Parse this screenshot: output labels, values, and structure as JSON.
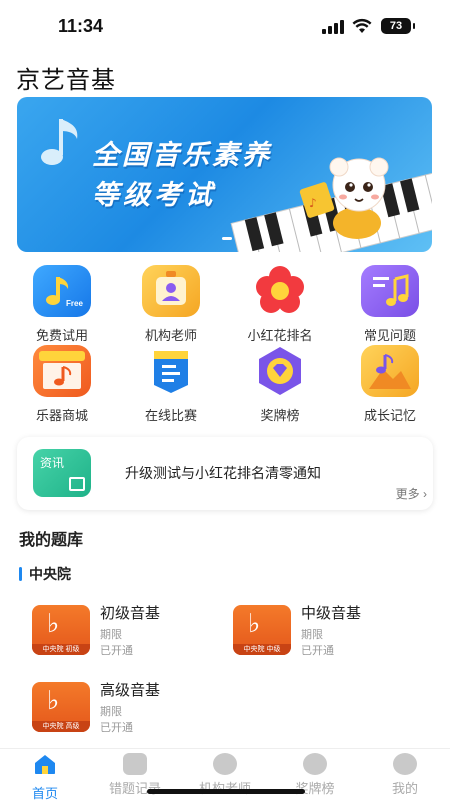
{
  "status_bar": {
    "time": "11:34",
    "battery": "73"
  },
  "app_title": "京艺音基",
  "banner": {
    "line1": "全国音乐素养",
    "line2": "等级考试"
  },
  "grid": [
    {
      "label": "免费试用",
      "icon": "music-note-free-icon",
      "color": "#1e8ff0"
    },
    {
      "label": "机构老师",
      "icon": "teacher-badge-icon",
      "color": "#f5c542"
    },
    {
      "label": "小红花排名",
      "icon": "red-flower-icon",
      "color": "#f0303a"
    },
    {
      "label": "常见问题",
      "icon": "faq-music-icon",
      "color": "#8a5cf0"
    },
    {
      "label": "乐器商城",
      "icon": "shop-icon",
      "color": "#f26b2c"
    },
    {
      "label": "在线比赛",
      "icon": "contest-flag-icon",
      "color": "#1f7fe6"
    },
    {
      "label": "奖牌榜",
      "icon": "medal-icon",
      "color": "#7a55e8"
    },
    {
      "label": "成长记忆",
      "icon": "growth-memory-icon",
      "color": "#f5b52c"
    }
  ],
  "notice": {
    "tag": "资讯",
    "text": "升级测试与小红花排名清零通知",
    "more": "更多"
  },
  "my_bank": {
    "title": "我的题库",
    "group": "中央院",
    "courses": [
      {
        "name": "初级音基",
        "period": "期限",
        "status": "已开通",
        "badge": "中央院 初级"
      },
      {
        "name": "中级音基",
        "period": "期限",
        "status": "已开通",
        "badge": "中央院 中级"
      },
      {
        "name": "高级音基",
        "period": "期限",
        "status": "已开通",
        "badge": "中央院 高级"
      }
    ]
  },
  "tabs": [
    {
      "label": "首页",
      "icon": "home-icon"
    },
    {
      "label": "错题记录",
      "icon": "wrong-record-icon"
    },
    {
      "label": "机构老师",
      "icon": "institution-teacher-icon"
    },
    {
      "label": "奖牌榜",
      "icon": "medal-rank-icon"
    },
    {
      "label": "我的",
      "icon": "profile-icon"
    }
  ],
  "colors": {
    "accent": "#1e88f0",
    "course_orange": "#ec6a24"
  }
}
